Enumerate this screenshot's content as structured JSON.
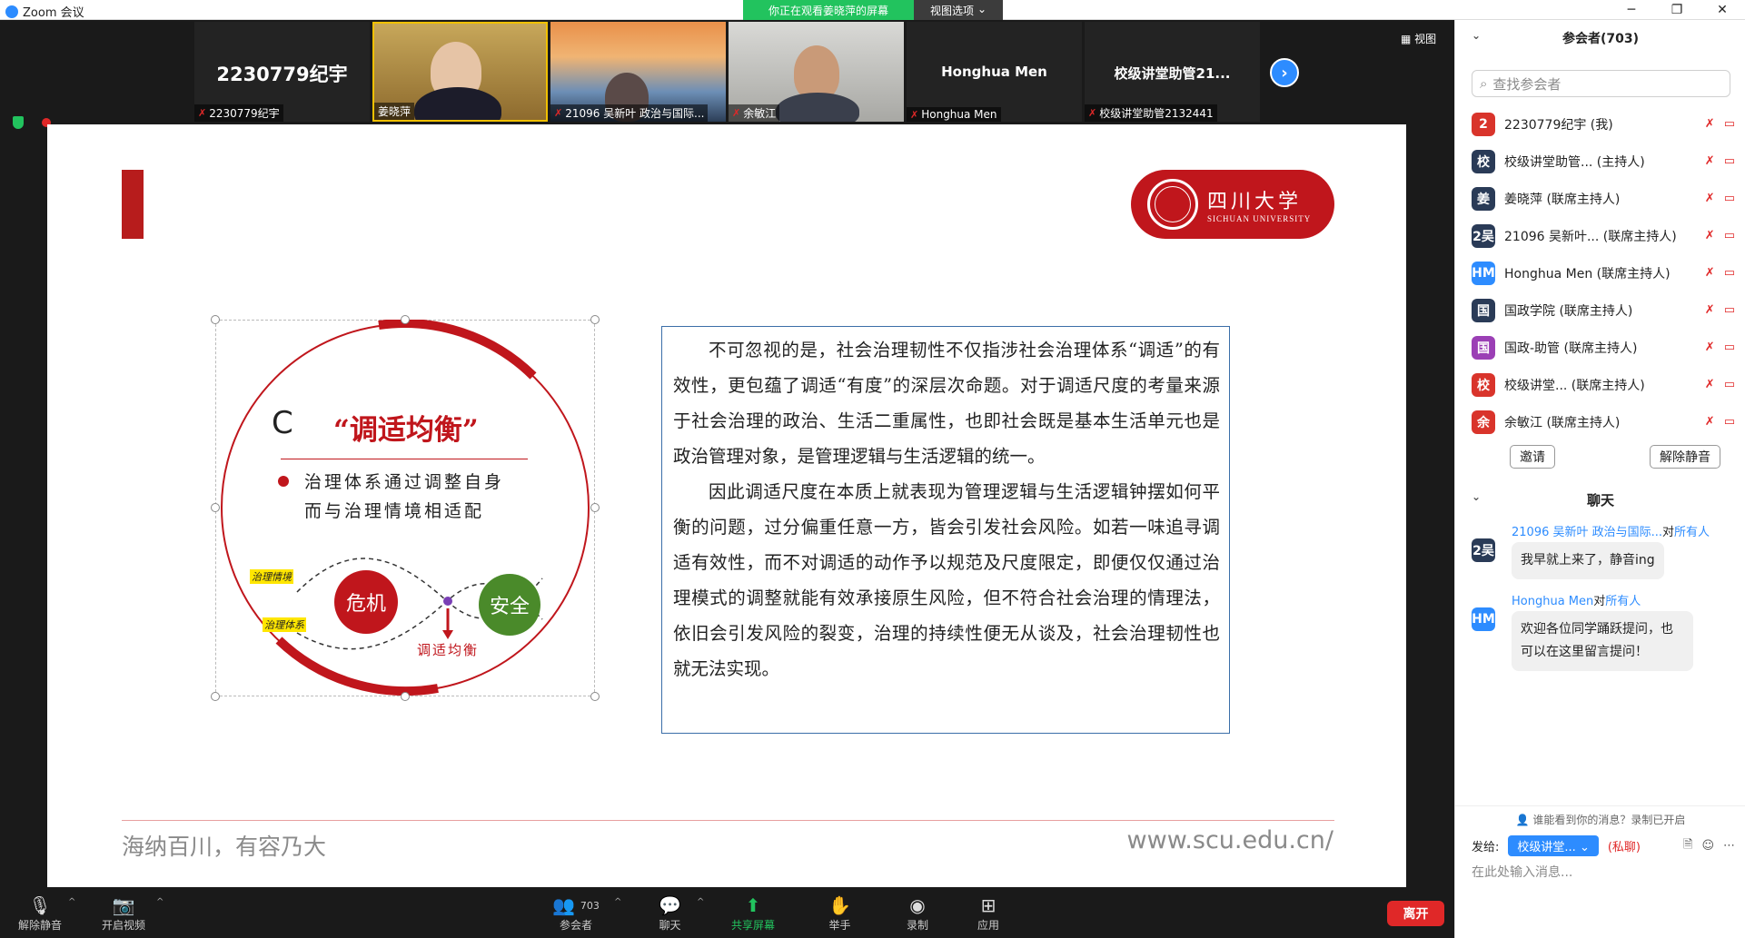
{
  "window": {
    "title": "Zoom 会议"
  },
  "banner": {
    "sharing_text": "你正在观看姜晓萍的屏幕",
    "view_options": "视图选项"
  },
  "top_view_label": "视图",
  "video_strip": [
    {
      "display": "2230779纪宇",
      "label": "2230779纪宇"
    },
    {
      "display": "",
      "label": "姜晓萍"
    },
    {
      "display": "",
      "label": "21096 吴新叶 政治与国际..."
    },
    {
      "display": "",
      "label": "余敏江"
    },
    {
      "display": "Honghua Men",
      "label": "Honghua Men"
    },
    {
      "display": "校级讲堂助管21...",
      "label": "校级讲堂助管2132441"
    }
  ],
  "slide": {
    "logo": {
      "cn": "四川大学",
      "en": "SICHUAN UNIVERSITY"
    },
    "diagram": {
      "c_letter": "C",
      "title": "“调适均衡”",
      "bullet_line1": "治理体系通过调整自身",
      "bullet_line2": "而与治理情境相适配",
      "tag_context": "治理情境",
      "tag_system": "治理体系",
      "crisis": "危机",
      "safe": "安全",
      "adjust": "调适均衡"
    },
    "para1": "不可忽视的是，社会治理韧性不仅指涉社会治理体系“调适”的有效性，更包蕴了调适“有度”的深层次命题。对于调适尺度的考量来源于社会治理的政治、生活二重属性，也即社会既是基本生活单元也是政治管理对象，是管理逻辑与生活逻辑的统一。",
    "para2": "因此调适尺度在本质上就表现为管理逻辑与生活逻辑钟摆如何平衡的问题，过分偏重任意一方，皆会引发社会风险。如若一味追寻调适有效性，而不对调适的动作予以规范及尺度限定，即便仅仅通过治理模式的调整就能有效承接原生风险，但不符合社会治理的情理法，依旧会引发风险的裂变，治理的持续性便无从谈及，社会治理韧性也就无法实现。",
    "footer_left": "海纳百川，有容乃大",
    "footer_right": "www.scu.edu.cn/"
  },
  "toolbar": {
    "unmute": "解除静音",
    "start_video": "开启视频",
    "participants": "参会者",
    "participants_count": "703",
    "chat": "聊天",
    "share": "共享屏幕",
    "raise_hand": "举手",
    "record": "录制",
    "apps": "应用",
    "leave": "离开"
  },
  "panel": {
    "participants_title": "参会者(703)",
    "search_placeholder": "查找参会者",
    "participants": [
      {
        "avatar": "2",
        "color": "#d9342b",
        "name": "2230779纪宇 (我)"
      },
      {
        "avatar": "校",
        "color": "#2a3b57",
        "name": "校级讲堂助管... (主持人)"
      },
      {
        "avatar": "姜",
        "color": "#2a3b57",
        "name": "姜晓萍 (联席主持人)"
      },
      {
        "avatar": "2吴",
        "color": "#2a3b57",
        "name": "21096 吴新叶... (联席主持人)"
      },
      {
        "avatar": "HM",
        "color": "#2d8cff",
        "name": "Honghua Men (联席主持人)"
      },
      {
        "avatar": "国",
        "color": "#2a3b57",
        "name": "国政学院 (联席主持人)"
      },
      {
        "avatar": "国",
        "color": "#9b3fb5",
        "name": "国政-助管 (联席主持人)"
      },
      {
        "avatar": "校",
        "color": "#d9342b",
        "name": "校级讲堂... (联席主持人)"
      },
      {
        "avatar": "余",
        "color": "#d9342b",
        "name": "余敏江 (联席主持人)"
      }
    ],
    "invite": "邀请",
    "unmute_all": "解除静音",
    "chat_title": "聊天",
    "messages": [
      {
        "avatar": "2吴",
        "color": "#2a3b57",
        "from": "21096 吴新叶 政治与国际...",
        "to_prefix": "对",
        "to": "所有人",
        "text": "我早就上来了，静音ing"
      },
      {
        "avatar": "HM",
        "color": "#2d8cff",
        "from": "Honghua Men",
        "to_prefix": "对",
        "to": "所有人",
        "text": "欢迎各位同学踊跃提问，也可以在这里留言提问！"
      }
    ],
    "who_can_see": "谁能看到你的消息？录制已开启",
    "send_label": "发给:",
    "send_target": "校级讲堂...",
    "private": "(私聊)",
    "input_placeholder": "在此处输入消息..."
  }
}
